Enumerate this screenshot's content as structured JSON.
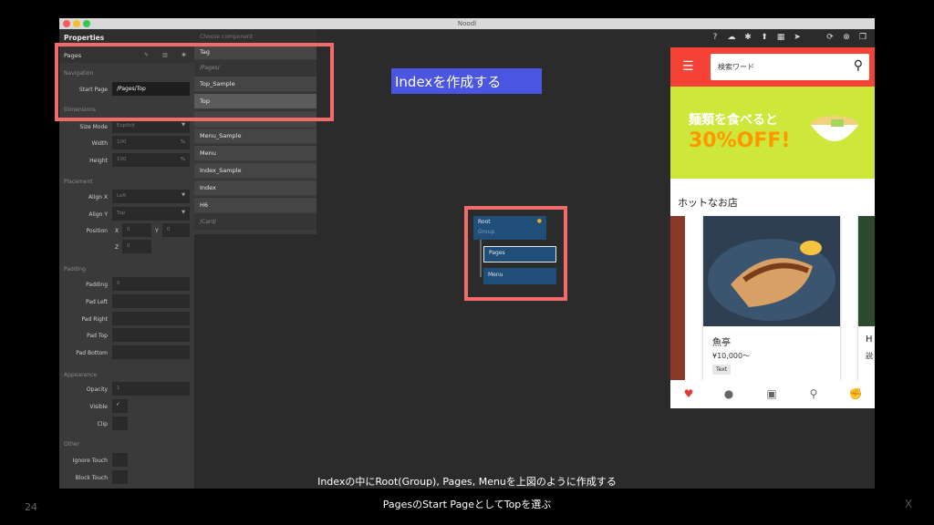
{
  "window": {
    "title": "Noodl"
  },
  "properties": {
    "title": "Properties",
    "pages_label": "Pages",
    "sections": {
      "navigation": "Navigation",
      "dimensions": "Dimensions",
      "placement": "Placement",
      "padding": "Padding",
      "appearance": "Appearance",
      "other": "Other"
    },
    "start_page": {
      "label": "Start Page",
      "value": "/Pages/Top"
    },
    "size_mode": {
      "label": "Size Mode",
      "value": "Explicit"
    },
    "width": {
      "label": "Width",
      "value": "100",
      "unit": "%"
    },
    "height": {
      "label": "Height",
      "value": "100",
      "unit": "%"
    },
    "align_x": {
      "label": "Align X",
      "value": "Left"
    },
    "align_y": {
      "label": "Align Y",
      "value": "Top"
    },
    "position": {
      "label": "Position",
      "x_label": "X",
      "x_value": "0",
      "y_label": "Y",
      "y_value": "0",
      "z_label": "Z",
      "z_value": "0"
    },
    "padding": {
      "label": "Padding",
      "value": "0"
    },
    "pad_left": {
      "label": "Pad Left",
      "value": ""
    },
    "pad_right": {
      "label": "Pad Right",
      "value": ""
    },
    "pad_top": {
      "label": "Pad Top",
      "value": ""
    },
    "pad_bottom": {
      "label": "Pad Bottom",
      "value": ""
    },
    "opacity": {
      "label": "Opacity",
      "value": "1"
    },
    "visible": {
      "label": "Visible",
      "checked": true
    },
    "clip": {
      "label": "Clip"
    },
    "ignore_touch": {
      "label": "Ignore Touch"
    },
    "block_touch": {
      "label": "Block Touch"
    }
  },
  "component_picker": {
    "header": "Choose component",
    "items": {
      "tag": "Tag",
      "cat_pages": "/Pages/",
      "top_sample": "Top_Sample",
      "top": "Top",
      "menu_sample": "Menu_Sample",
      "menu": "Menu",
      "index_sample": "Index_Sample",
      "index": "Index",
      "h6": "H6",
      "cat_card": "/Card/"
    }
  },
  "graph": {
    "root_title": "Root",
    "root_subtitle": "Group",
    "pages": "Pages",
    "menu": "Menu"
  },
  "annotation": {
    "badge": "Indexを作成する"
  },
  "phone": {
    "search_placeholder": "検索ワード",
    "banner_line1": "麺類を食べると",
    "banner_line2": "30%OFF!",
    "section_title": "ホットなお店",
    "card": {
      "name": "魚亭",
      "price": "¥10,000〜",
      "tag": "Text"
    },
    "card2": {
      "name": "H",
      "price": "説"
    }
  },
  "captions": {
    "line1": "Indexの中にRoot(Group), Pages, Menuを上図のように作成する",
    "line2": "PagesのStart PageとしてTopを選ぶ"
  },
  "slide": {
    "number": "24",
    "mark": "X"
  },
  "colors": {
    "highlight": "#f26a6a",
    "badge": "#4a56e2",
    "phone_header": "#f44336",
    "banner": "#cde83a",
    "banner_accent": "#ff9800",
    "node": "#1f4e79"
  }
}
